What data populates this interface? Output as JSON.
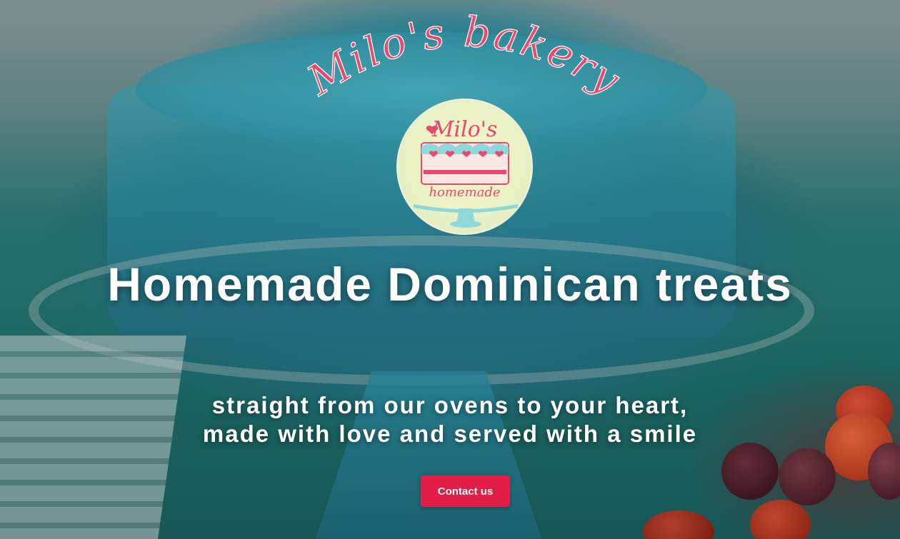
{
  "brand": {
    "arc_text": "Milo's bakery",
    "logo_title": "Milo's",
    "logo_subtitle": "homemade"
  },
  "hero": {
    "headline": "Homemade Dominican treats",
    "tagline_line1": "straight from our ovens to your heart,",
    "tagline_line2": "made with love and served with a smile",
    "cta_label": "Contact us"
  },
  "colors": {
    "accent": "#e11d48",
    "brand_pink": "#e8496e",
    "cake_teal": "#2f8c9c"
  },
  "icons": {
    "logo_illustration": "cake-stand-icon"
  }
}
